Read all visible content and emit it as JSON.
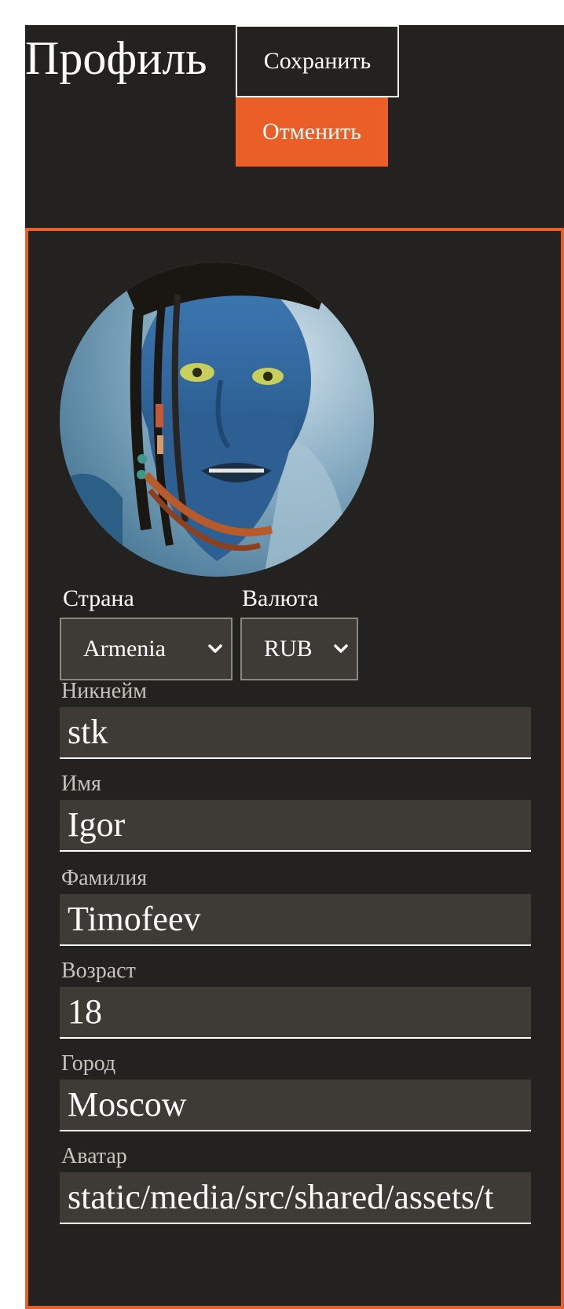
{
  "header": {
    "title": "Профиль",
    "save_label": "Сохранить",
    "cancel_label": "Отменить"
  },
  "colors": {
    "accent": "#ec5e27",
    "background": "#242220",
    "input_background": "#3e3a35",
    "text": "#ffffff",
    "label_text": "#c9c4bb"
  },
  "profile": {
    "avatar_icon": "avatar-photo",
    "country": {
      "label": "Страна",
      "value": "Armenia"
    },
    "currency": {
      "label": "Валюта",
      "value": "RUB"
    },
    "fields": [
      {
        "label": "Никнейм",
        "value": "stk"
      },
      {
        "label": "Имя",
        "value": "Igor"
      },
      {
        "label": "Фамилия",
        "value": "Timofeev"
      },
      {
        "label": "Возраст",
        "value": "18"
      },
      {
        "label": "Город",
        "value": "Moscow"
      },
      {
        "label": "Аватар",
        "value": "static/media/src/shared/assets/t"
      }
    ]
  }
}
